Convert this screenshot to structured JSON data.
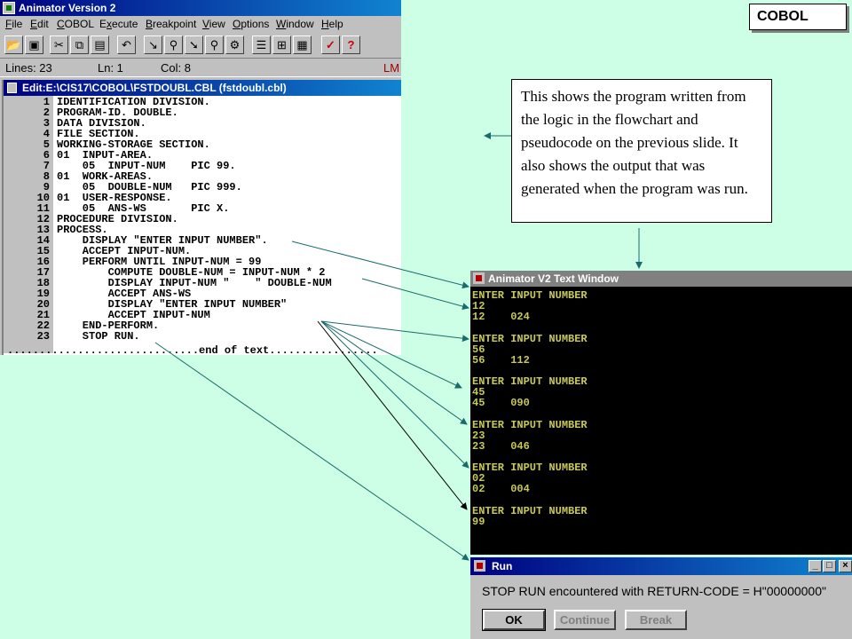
{
  "slide_label": "COBOL",
  "animator": {
    "title": "Animator Version 2",
    "menus": [
      "File",
      "Edit",
      "COBOL",
      "Execute",
      "Breakpoint",
      "View",
      "Options",
      "Window",
      "Help"
    ],
    "menu_mnemonics": [
      "F",
      "E",
      "C",
      "x",
      "B",
      "V",
      "O",
      "W",
      "H"
    ],
    "status": {
      "lines": "Lines: 23",
      "ln": "Ln: 1",
      "col": "Col: 8",
      "mode": "LM"
    }
  },
  "editor": {
    "title": "Edit:E:\\CIS17\\COBOL\\FSTDOUBL.CBL (fstdoubl.cbl)",
    "line_numbers": [
      "1",
      "2",
      "3",
      "4",
      "5",
      "6",
      "7",
      "8",
      "9",
      "10",
      "11",
      "12",
      "13",
      "14",
      "15",
      "16",
      "17",
      "18",
      "19",
      "20",
      "21",
      "22",
      "23"
    ],
    "code": [
      "IDENTIFICATION DIVISION.",
      "PROGRAM-ID. DOUBLE.",
      "DATA DIVISION.",
      "FILE SECTION.",
      "WORKING-STORAGE SECTION.",
      "01  INPUT-AREA.",
      "    05  INPUT-NUM    PIC 99.",
      "01  WORK-AREAS.",
      "    05  DOUBLE-NUM   PIC 999.",
      "01  USER-RESPONSE.",
      "    05  ANS-WS       PIC X.",
      "PROCEDURE DIVISION.",
      "PROCESS.",
      "    DISPLAY \"ENTER INPUT NUMBER\".",
      "    ACCEPT INPUT-NUM.",
      "    PERFORM UNTIL INPUT-NUM = 99",
      "        COMPUTE DOUBLE-NUM = INPUT-NUM * 2",
      "        DISPLAY INPUT-NUM \"    \" DOUBLE-NUM",
      "        ACCEPT ANS-WS",
      "        DISPLAY \"ENTER INPUT NUMBER\"",
      "        ACCEPT INPUT-NUM",
      "    END-PERFORM.",
      "    STOP RUN."
    ],
    "end_marker": "..............................end of text................."
  },
  "callout": "This shows the program written from the logic in the flowchart and pseudocode on the previous slide.  It also shows the output that was generated when the program was run.",
  "text_window": {
    "title": "Animator V2 Text Window",
    "lines": [
      "ENTER INPUT NUMBER",
      "12",
      "12    024",
      "ENTER INPUT NUMBER",
      "56",
      "56    112",
      "ENTER INPUT NUMBER",
      "45",
      "45    090",
      "ENTER INPUT NUMBER",
      "23",
      "23    046",
      "ENTER INPUT NUMBER",
      "02",
      "02    004",
      "ENTER INPUT NUMBER",
      "99"
    ]
  },
  "run_dialog": {
    "title": "Run",
    "message": "STOP RUN encountered with RETURN-CODE =  H\"00000000\"",
    "ok": "OK",
    "continue": "Continue",
    "break": "Break"
  }
}
